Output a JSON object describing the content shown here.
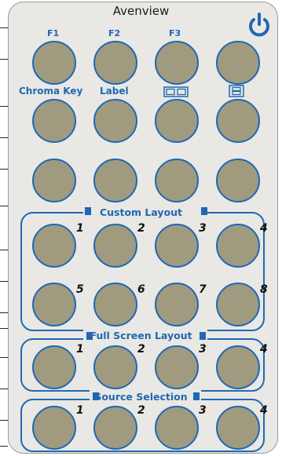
{
  "brand": "Avenview",
  "colors": {
    "accent": "#1f68b4",
    "button_fill": "#a09a7f",
    "panel": "#e9e8e4"
  },
  "icons": {
    "power": "power-icon",
    "dual_layout": "side-by-side-layout-icon",
    "split_layout": "top-bottom-layout-icon"
  },
  "top_labels": {
    "f1": "F1",
    "f2": "F2",
    "f3": "F3"
  },
  "mid_labels": {
    "chroma_key": "Chroma Key",
    "label": "Label"
  },
  "sections": {
    "custom_layout": "Custom Layout",
    "full_screen_layout": "Full Screen Layout",
    "source_selection": "Source Selection"
  },
  "custom_numbers": [
    "1",
    "2",
    "3",
    "4",
    "5",
    "6",
    "7",
    "8"
  ],
  "full_numbers": [
    "1",
    "2",
    "3",
    "4"
  ],
  "source_numbers": [
    "1",
    "2",
    "3",
    "4"
  ]
}
